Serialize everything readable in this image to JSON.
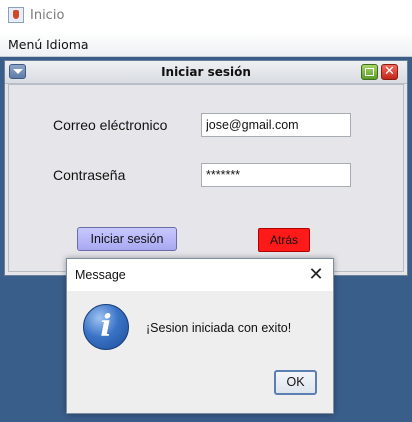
{
  "window": {
    "title": "Inicio"
  },
  "menubar": {
    "items": [
      "Menú",
      "Idioma"
    ]
  },
  "internal_frame": {
    "title": "Iniciar sesión",
    "email_label": "Correo eléctronico",
    "email_value": "jose@gmail.com",
    "password_label": "Contraseña",
    "password_value": "*******",
    "login_button": "Iniciar sesión",
    "back_button": "Atrás",
    "close_glyph": "✕"
  },
  "dialog": {
    "title": "Message",
    "message": "¡Sesion iniciada con exito!",
    "ok_button": "OK",
    "close_glyph": "✕",
    "icon_glyph": "i"
  }
}
